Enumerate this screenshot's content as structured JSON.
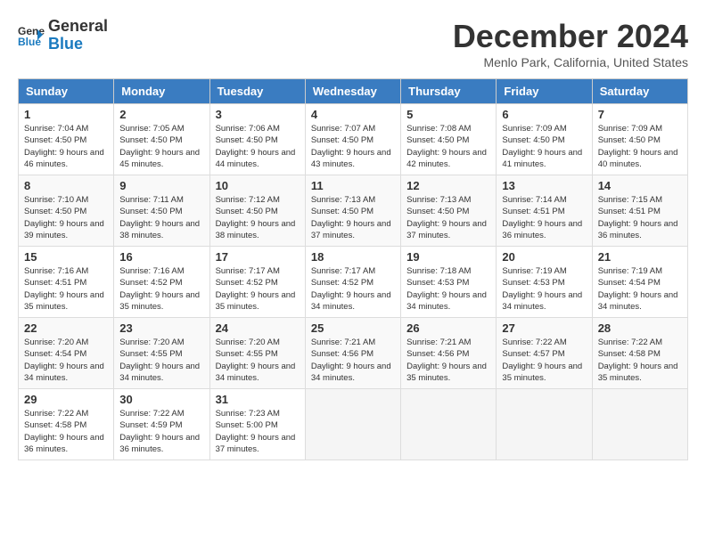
{
  "header": {
    "logo_line1": "General",
    "logo_line2": "Blue",
    "month_title": "December 2024",
    "location": "Menlo Park, California, United States"
  },
  "weekdays": [
    "Sunday",
    "Monday",
    "Tuesday",
    "Wednesday",
    "Thursday",
    "Friday",
    "Saturday"
  ],
  "weeks": [
    [
      {
        "day": "1",
        "sunrise": "Sunrise: 7:04 AM",
        "sunset": "Sunset: 4:50 PM",
        "daylight": "Daylight: 9 hours and 46 minutes."
      },
      {
        "day": "2",
        "sunrise": "Sunrise: 7:05 AM",
        "sunset": "Sunset: 4:50 PM",
        "daylight": "Daylight: 9 hours and 45 minutes."
      },
      {
        "day": "3",
        "sunrise": "Sunrise: 7:06 AM",
        "sunset": "Sunset: 4:50 PM",
        "daylight": "Daylight: 9 hours and 44 minutes."
      },
      {
        "day": "4",
        "sunrise": "Sunrise: 7:07 AM",
        "sunset": "Sunset: 4:50 PM",
        "daylight": "Daylight: 9 hours and 43 minutes."
      },
      {
        "day": "5",
        "sunrise": "Sunrise: 7:08 AM",
        "sunset": "Sunset: 4:50 PM",
        "daylight": "Daylight: 9 hours and 42 minutes."
      },
      {
        "day": "6",
        "sunrise": "Sunrise: 7:09 AM",
        "sunset": "Sunset: 4:50 PM",
        "daylight": "Daylight: 9 hours and 41 minutes."
      },
      {
        "day": "7",
        "sunrise": "Sunrise: 7:09 AM",
        "sunset": "Sunset: 4:50 PM",
        "daylight": "Daylight: 9 hours and 40 minutes."
      }
    ],
    [
      {
        "day": "8",
        "sunrise": "Sunrise: 7:10 AM",
        "sunset": "Sunset: 4:50 PM",
        "daylight": "Daylight: 9 hours and 39 minutes."
      },
      {
        "day": "9",
        "sunrise": "Sunrise: 7:11 AM",
        "sunset": "Sunset: 4:50 PM",
        "daylight": "Daylight: 9 hours and 38 minutes."
      },
      {
        "day": "10",
        "sunrise": "Sunrise: 7:12 AM",
        "sunset": "Sunset: 4:50 PM",
        "daylight": "Daylight: 9 hours and 38 minutes."
      },
      {
        "day": "11",
        "sunrise": "Sunrise: 7:13 AM",
        "sunset": "Sunset: 4:50 PM",
        "daylight": "Daylight: 9 hours and 37 minutes."
      },
      {
        "day": "12",
        "sunrise": "Sunrise: 7:13 AM",
        "sunset": "Sunset: 4:50 PM",
        "daylight": "Daylight: 9 hours and 37 minutes."
      },
      {
        "day": "13",
        "sunrise": "Sunrise: 7:14 AM",
        "sunset": "Sunset: 4:51 PM",
        "daylight": "Daylight: 9 hours and 36 minutes."
      },
      {
        "day": "14",
        "sunrise": "Sunrise: 7:15 AM",
        "sunset": "Sunset: 4:51 PM",
        "daylight": "Daylight: 9 hours and 36 minutes."
      }
    ],
    [
      {
        "day": "15",
        "sunrise": "Sunrise: 7:16 AM",
        "sunset": "Sunset: 4:51 PM",
        "daylight": "Daylight: 9 hours and 35 minutes."
      },
      {
        "day": "16",
        "sunrise": "Sunrise: 7:16 AM",
        "sunset": "Sunset: 4:52 PM",
        "daylight": "Daylight: 9 hours and 35 minutes."
      },
      {
        "day": "17",
        "sunrise": "Sunrise: 7:17 AM",
        "sunset": "Sunset: 4:52 PM",
        "daylight": "Daylight: 9 hours and 35 minutes."
      },
      {
        "day": "18",
        "sunrise": "Sunrise: 7:17 AM",
        "sunset": "Sunset: 4:52 PM",
        "daylight": "Daylight: 9 hours and 34 minutes."
      },
      {
        "day": "19",
        "sunrise": "Sunrise: 7:18 AM",
        "sunset": "Sunset: 4:53 PM",
        "daylight": "Daylight: 9 hours and 34 minutes."
      },
      {
        "day": "20",
        "sunrise": "Sunrise: 7:19 AM",
        "sunset": "Sunset: 4:53 PM",
        "daylight": "Daylight: 9 hours and 34 minutes."
      },
      {
        "day": "21",
        "sunrise": "Sunrise: 7:19 AM",
        "sunset": "Sunset: 4:54 PM",
        "daylight": "Daylight: 9 hours and 34 minutes."
      }
    ],
    [
      {
        "day": "22",
        "sunrise": "Sunrise: 7:20 AM",
        "sunset": "Sunset: 4:54 PM",
        "daylight": "Daylight: 9 hours and 34 minutes."
      },
      {
        "day": "23",
        "sunrise": "Sunrise: 7:20 AM",
        "sunset": "Sunset: 4:55 PM",
        "daylight": "Daylight: 9 hours and 34 minutes."
      },
      {
        "day": "24",
        "sunrise": "Sunrise: 7:20 AM",
        "sunset": "Sunset: 4:55 PM",
        "daylight": "Daylight: 9 hours and 34 minutes."
      },
      {
        "day": "25",
        "sunrise": "Sunrise: 7:21 AM",
        "sunset": "Sunset: 4:56 PM",
        "daylight": "Daylight: 9 hours and 34 minutes."
      },
      {
        "day": "26",
        "sunrise": "Sunrise: 7:21 AM",
        "sunset": "Sunset: 4:56 PM",
        "daylight": "Daylight: 9 hours and 35 minutes."
      },
      {
        "day": "27",
        "sunrise": "Sunrise: 7:22 AM",
        "sunset": "Sunset: 4:57 PM",
        "daylight": "Daylight: 9 hours and 35 minutes."
      },
      {
        "day": "28",
        "sunrise": "Sunrise: 7:22 AM",
        "sunset": "Sunset: 4:58 PM",
        "daylight": "Daylight: 9 hours and 35 minutes."
      }
    ],
    [
      {
        "day": "29",
        "sunrise": "Sunrise: 7:22 AM",
        "sunset": "Sunset: 4:58 PM",
        "daylight": "Daylight: 9 hours and 36 minutes."
      },
      {
        "day": "30",
        "sunrise": "Sunrise: 7:22 AM",
        "sunset": "Sunset: 4:59 PM",
        "daylight": "Daylight: 9 hours and 36 minutes."
      },
      {
        "day": "31",
        "sunrise": "Sunrise: 7:23 AM",
        "sunset": "Sunset: 5:00 PM",
        "daylight": "Daylight: 9 hours and 37 minutes."
      },
      {
        "day": "",
        "sunrise": "",
        "sunset": "",
        "daylight": ""
      },
      {
        "day": "",
        "sunrise": "",
        "sunset": "",
        "daylight": ""
      },
      {
        "day": "",
        "sunrise": "",
        "sunset": "",
        "daylight": ""
      },
      {
        "day": "",
        "sunrise": "",
        "sunset": "",
        "daylight": ""
      }
    ]
  ]
}
